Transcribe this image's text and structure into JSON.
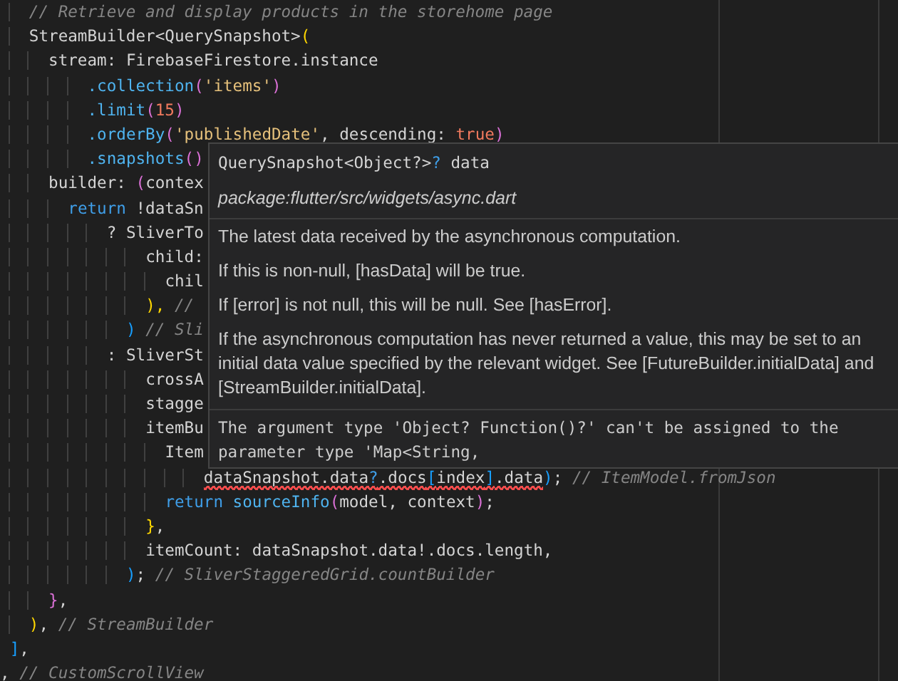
{
  "editor": {
    "lines": [
      {
        "tokens": [
          {
            "text": "   // Retrieve and display products in the storehome page",
            "kind": "comment"
          }
        ]
      },
      {
        "tokens": [
          {
            "text": "   StreamBuilder<QuerySnapshot>",
            "kind": "plain"
          },
          {
            "text": "(",
            "kind": "bracket1"
          }
        ]
      },
      {
        "tokens": [
          {
            "text": "     stream: FirebaseFirestore.instance",
            "kind": "plain"
          }
        ]
      },
      {
        "tokens": [
          {
            "text": "         .collection",
            "kind": "method"
          },
          {
            "text": "(",
            "kind": "bracket2"
          },
          {
            "text": "'items'",
            "kind": "string"
          },
          {
            "text": ")",
            "kind": "bracket2"
          }
        ]
      },
      {
        "tokens": [
          {
            "text": "         .limit",
            "kind": "method"
          },
          {
            "text": "(",
            "kind": "bracket2"
          },
          {
            "text": "15",
            "kind": "number"
          },
          {
            "text": ")",
            "kind": "bracket2"
          }
        ]
      },
      {
        "tokens": [
          {
            "text": "         .orderBy",
            "kind": "method"
          },
          {
            "text": "(",
            "kind": "bracket2"
          },
          {
            "text": "'publishedDate'",
            "kind": "string"
          },
          {
            "text": ", descending: ",
            "kind": "plain"
          },
          {
            "text": "true",
            "kind": "number"
          },
          {
            "text": ")",
            "kind": "bracket2"
          }
        ]
      },
      {
        "tokens": [
          {
            "text": "         .snapshots",
            "kind": "method"
          },
          {
            "text": "()",
            "kind": "bracket2"
          }
        ]
      },
      {
        "tokens": [
          {
            "text": "     builder: ",
            "kind": "plain"
          },
          {
            "text": "(",
            "kind": "bracket2"
          },
          {
            "text": "contex",
            "kind": "plain"
          }
        ]
      },
      {
        "tokens": [
          {
            "text": "       return",
            "kind": "keyword"
          },
          {
            "text": " !dataSn",
            "kind": "plain"
          }
        ]
      },
      {
        "tokens": [
          {
            "text": "           ? SliverTo",
            "kind": "plain"
          }
        ]
      },
      {
        "tokens": [
          {
            "text": "               child:",
            "kind": "plain"
          }
        ]
      },
      {
        "tokens": [
          {
            "text": "                 chil",
            "kind": "plain"
          }
        ]
      },
      {
        "tokens": [
          {
            "text": "               ),",
            "kind": "bracket1"
          },
          {
            "text": " //",
            "kind": "comment"
          }
        ]
      },
      {
        "tokens": [
          {
            "text": "             )",
            "kind": "bracket3"
          },
          {
            "text": " // Sli",
            "kind": "comment"
          }
        ]
      },
      {
        "tokens": [
          {
            "text": "           : SliverSt",
            "kind": "plain"
          }
        ]
      },
      {
        "tokens": [
          {
            "text": "               crossA",
            "kind": "plain"
          }
        ]
      },
      {
        "tokens": [
          {
            "text": "               stagge",
            "kind": "plain"
          }
        ]
      },
      {
        "tokens": [
          {
            "text": "               itemBu",
            "kind": "plain"
          }
        ]
      },
      {
        "tokens": [
          {
            "text": "                 Item",
            "kind": "plain"
          }
        ]
      },
      {
        "tokens": [
          {
            "text": "                     dataSnapshot.data",
            "kind": "plain",
            "squiggle": true
          },
          {
            "text": "?",
            "kind": "keyword",
            "squiggle": true
          },
          {
            "text": ".docs",
            "kind": "plain",
            "squiggle": true
          },
          {
            "text": "[",
            "kind": "bracket3",
            "squiggle": true
          },
          {
            "text": "index",
            "kind": "plain",
            "squiggle": true
          },
          {
            "text": "]",
            "kind": "bracket3",
            "squiggle": true
          },
          {
            "text": ".data",
            "kind": "plain",
            "squiggle": true
          },
          {
            "text": ")",
            "kind": "bracket3",
            "squiggle": false
          },
          {
            "text": "; ",
            "kind": "plain",
            "squiggle": false
          },
          {
            "text": "// ItemModel.fromJson",
            "kind": "comment",
            "squiggle": false
          }
        ]
      },
      {
        "tokens": [
          {
            "text": "                 return ",
            "kind": "keyword"
          },
          {
            "text": "sourceInfo",
            "kind": "method"
          },
          {
            "text": "(",
            "kind": "bracket2"
          },
          {
            "text": "model, context",
            "kind": "plain"
          },
          {
            "text": ")",
            "kind": "bracket2"
          },
          {
            "text": ";",
            "kind": "plain"
          }
        ]
      },
      {
        "tokens": [
          {
            "text": "               }",
            "kind": "bracket1"
          },
          {
            "text": ",",
            "kind": "plain"
          }
        ]
      },
      {
        "tokens": [
          {
            "text": "               itemCount: dataSnapshot.data!.docs.length,",
            "kind": "plain"
          }
        ]
      },
      {
        "tokens": [
          {
            "text": "             )",
            "kind": "bracket3"
          },
          {
            "text": "; ",
            "kind": "plain"
          },
          {
            "text": "// SliverStaggeredGrid.countBuilder",
            "kind": "comment"
          }
        ]
      },
      {
        "tokens": [
          {
            "text": "     }",
            "kind": "bracket2"
          },
          {
            "text": ",",
            "kind": "plain"
          }
        ]
      },
      {
        "tokens": [
          {
            "text": "   )",
            "kind": "bracket1"
          },
          {
            "text": ", ",
            "kind": "plain"
          },
          {
            "text": "// StreamBuilder",
            "kind": "comment"
          }
        ]
      },
      {
        "tokens": [
          {
            "text": " ]",
            "kind": "bracket3"
          },
          {
            "text": ",",
            "kind": "plain"
          }
        ]
      },
      {
        "tokens": [
          {
            "text": ", ",
            "kind": "plain"
          },
          {
            "text": "// CustomScrollView",
            "kind": "comment"
          }
        ]
      }
    ]
  },
  "hover": {
    "signature": [
      {
        "text": "QuerySnapshot<Object?>",
        "kind": "plain"
      },
      {
        "text": "?",
        "kind": "keyword"
      },
      {
        "text": " data",
        "kind": "plain"
      }
    ],
    "source": "package:flutter/src/widgets/async.dart",
    "docs": [
      "The latest data received by the asynchronous computation.",
      "If this is non-null, [hasData] will be true.",
      "If [error] is not null, this will be null. See [hasError].",
      "If the asynchronous computation has never returned a value, this may be set to an initial data value specified by the relevant widget. See [FutureBuilder.initialData] and [StreamBuilder.initialData]."
    ],
    "problem": "The argument type 'Object? Function()?' can't be assigned to the parameter type 'Map<String,"
  }
}
